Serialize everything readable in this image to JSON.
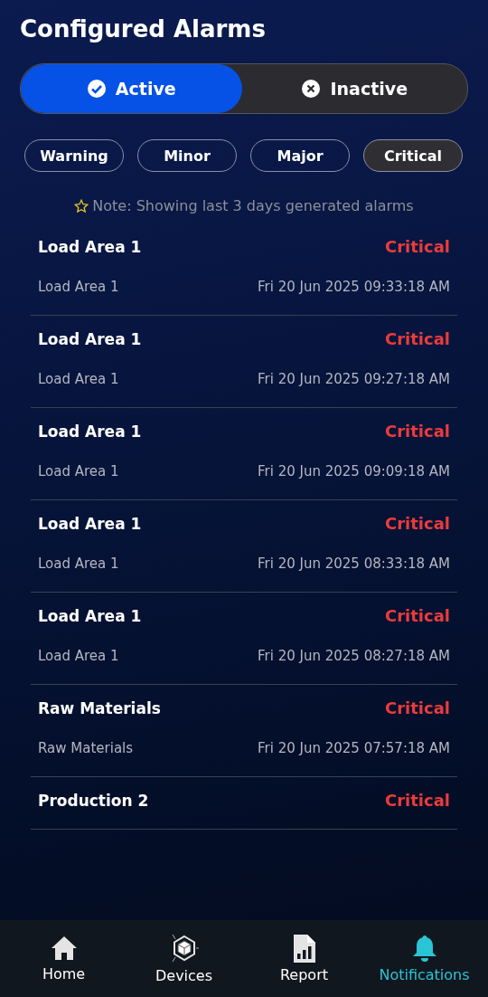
{
  "title": "Configured Alarms",
  "status_tabs": [
    {
      "label": "Active",
      "kind": "check",
      "selected": true
    },
    {
      "label": "Inactive",
      "kind": "cross",
      "selected": false
    }
  ],
  "filters": [
    {
      "label": "Warning",
      "selected": false
    },
    {
      "label": "Minor",
      "selected": false
    },
    {
      "label": "Major",
      "selected": false
    },
    {
      "label": "Critical",
      "selected": true
    }
  ],
  "note": "Note: Showing last 3 days generated alarms",
  "alarms": [
    {
      "name": "Load Area 1",
      "severity": "Critical",
      "source": "Load Area 1",
      "time": "Fri 20 Jun 2025 09:33:18 AM"
    },
    {
      "name": "Load Area 1",
      "severity": "Critical",
      "source": "Load Area 1",
      "time": "Fri 20 Jun 2025 09:27:18 AM"
    },
    {
      "name": "Load Area 1",
      "severity": "Critical",
      "source": "Load Area 1",
      "time": "Fri 20 Jun 2025 09:09:18 AM"
    },
    {
      "name": "Load Area 1",
      "severity": "Critical",
      "source": "Load Area 1",
      "time": "Fri 20 Jun 2025 08:33:18 AM"
    },
    {
      "name": "Load Area 1",
      "severity": "Critical",
      "source": "Load Area 1",
      "time": "Fri 20 Jun 2025 08:27:18 AM"
    },
    {
      "name": "Raw Materials",
      "severity": "Critical",
      "source": "Raw Materials",
      "time": "Fri 20 Jun 2025 07:57:18 AM"
    },
    {
      "name": "Production 2",
      "severity": "Critical"
    }
  ],
  "nav": [
    {
      "label": "Home",
      "kind": "home",
      "selected": false
    },
    {
      "label": "Devices",
      "kind": "devices",
      "selected": false
    },
    {
      "label": "Report",
      "kind": "report",
      "selected": false
    },
    {
      "label": "Notifications",
      "kind": "bell",
      "selected": true
    }
  ]
}
